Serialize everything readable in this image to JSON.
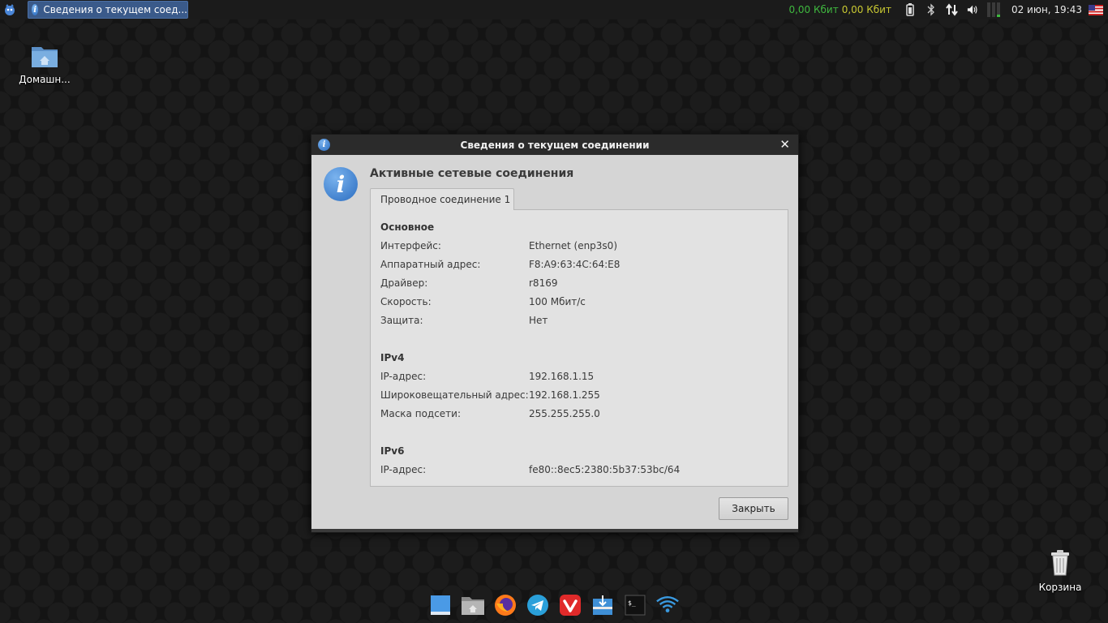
{
  "panel": {
    "task_title": "Сведения о текущем соед...",
    "net_down": "0,00 Кбит",
    "net_up": "0,00 Кбит",
    "clock": "02 июн, 19:43"
  },
  "desktop": {
    "home_label": "Домашн...",
    "trash_label": "Корзина"
  },
  "dialog": {
    "title": "Сведения о текущем соединении",
    "heading": "Активные сетевые соединения",
    "tab_label": "Проводное соединение 1",
    "close_button": "Закрыть",
    "sections": [
      {
        "title": "Основное",
        "rows": [
          {
            "label": "Интерфейс:",
            "value": "Ethernet (enp3s0)"
          },
          {
            "label": "Аппаратный адрес:",
            "value": "F8:A9:63:4C:64:E8"
          },
          {
            "label": "Драйвер:",
            "value": "r8169"
          },
          {
            "label": "Скорость:",
            "value": "100 Мбит/с"
          },
          {
            "label": "Защита:",
            "value": "Нет"
          }
        ]
      },
      {
        "title": "IPv4",
        "rows": [
          {
            "label": "IP-адрес:",
            "value": "192.168.1.15"
          },
          {
            "label": "Широковещательный адрес:",
            "value": "192.168.1.255"
          },
          {
            "label": "Маска подсети:",
            "value": "255.255.255.0"
          }
        ]
      },
      {
        "title": "IPv6",
        "rows": [
          {
            "label": "IP-адрес:",
            "value": "fe80::8ec5:2380:5b37:53bc/64"
          }
        ]
      }
    ]
  },
  "colors": {
    "accent": "#3a5a8a",
    "net_down": "#3fb83f",
    "net_up": "#c8c832"
  }
}
